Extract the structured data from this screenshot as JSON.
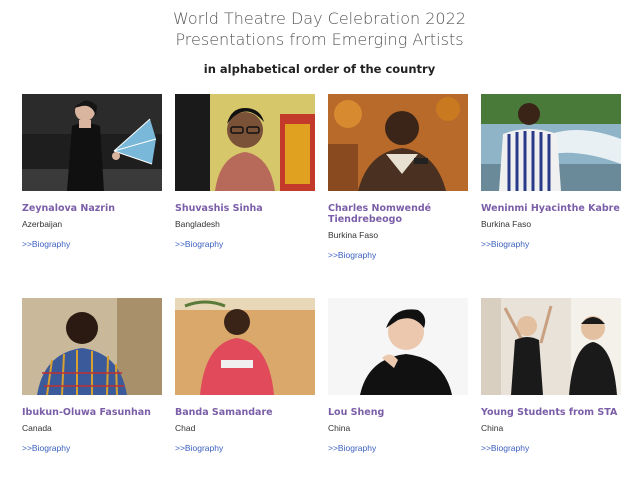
{
  "header": {
    "title_line1": "World Theatre Day Celebration 2022",
    "title_line2": "Presentations from Emerging Artists",
    "subtitle": "in alphabetical order of the country"
  },
  "artists": [
    {
      "name": "Zeynalova Nazrin",
      "country": "Azerbaijan",
      "link": ">>Biography"
    },
    {
      "name": "Shuvashis Sinha",
      "country": "Bangladesh",
      "link": ">>Biography"
    },
    {
      "name": "Charles Nomwendé Tiendrebeogo",
      "country": "Burkina Faso",
      "link": ">>Biography"
    },
    {
      "name": "Weninmi Hyacinthe Kabre",
      "country": "Burkina Faso",
      "link": ">>Biography"
    },
    {
      "name": "Ibukun-Oluwa Fasunhan",
      "country": "Canada",
      "link": ">>Biography"
    },
    {
      "name": "Banda Samandare",
      "country": "Chad",
      "link": ">>Biography"
    },
    {
      "name": "Lou Sheng",
      "country": "China",
      "link": ">>Biography"
    },
    {
      "name": "Young Students from STA",
      "country": "China",
      "link": ">>Biography"
    }
  ],
  "colors": {
    "name": "#7b5ea8",
    "link": "#3a5fbf",
    "title": "#555555"
  }
}
